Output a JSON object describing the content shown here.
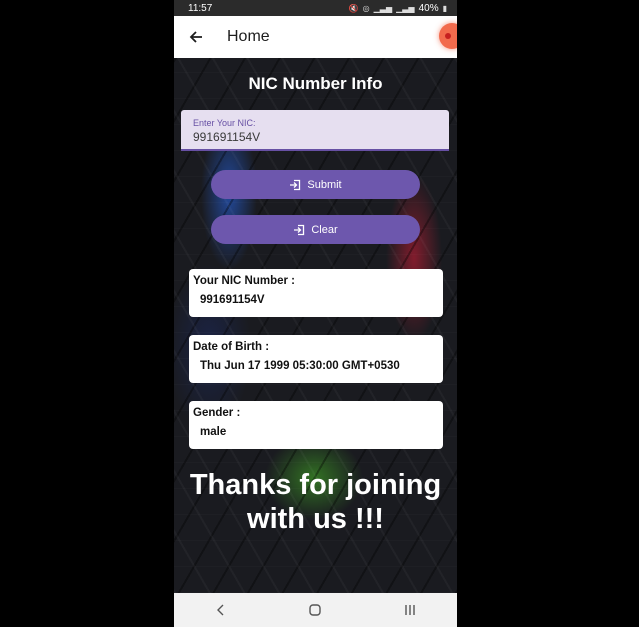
{
  "status_bar": {
    "time": "11:57",
    "battery": "40%"
  },
  "app_bar": {
    "title": "Home"
  },
  "page": {
    "title": "NIC Number Info"
  },
  "nic_input": {
    "label": "Enter Your NIC:",
    "value": "991691154V"
  },
  "buttons": {
    "submit": "Submit",
    "clear": "Clear"
  },
  "results": [
    {
      "label": "Your NIC Number :",
      "value": "991691154V"
    },
    {
      "label": "Date of Birth :",
      "value": "Thu Jun 17 1999 05:30:00 GMT+0530"
    },
    {
      "label": "Gender :",
      "value": "male"
    }
  ],
  "thanks": {
    "line1": "Thanks for joining",
    "line2": "with us !!!"
  },
  "colors": {
    "accent": "#6d57ad",
    "input_bg": "#e6dff0",
    "fab": "#f26b4d"
  },
  "icons": {
    "back": "arrow-left-icon",
    "submit": "login-icon",
    "clear": "login-icon"
  }
}
